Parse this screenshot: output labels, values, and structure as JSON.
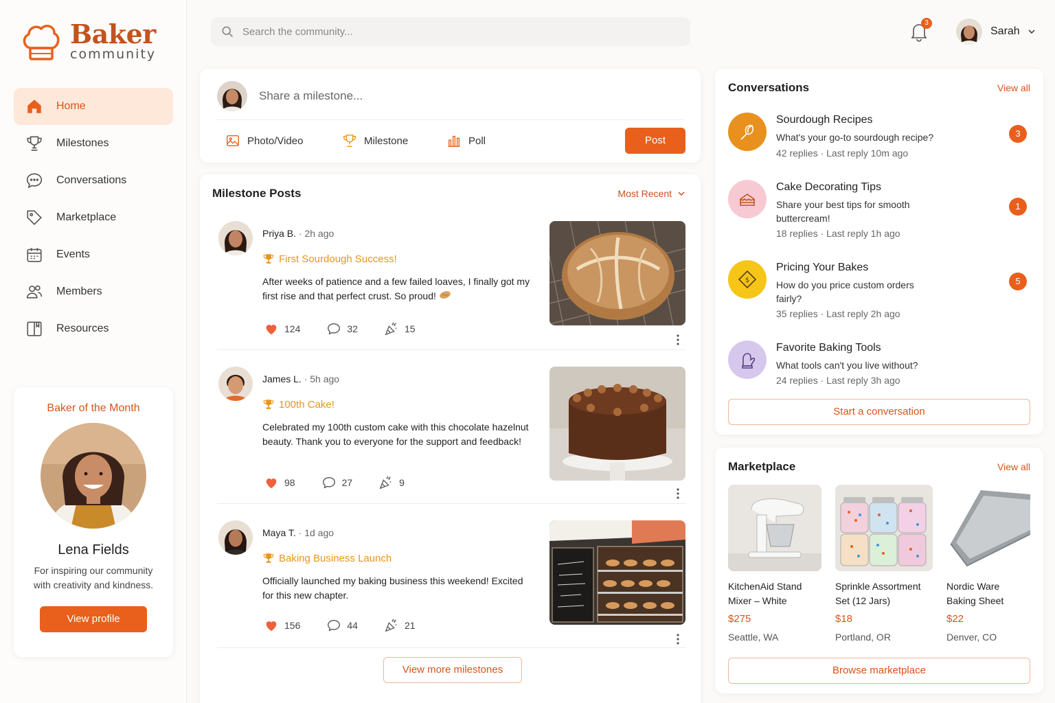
{
  "app": {
    "logo_title": "Baker",
    "logo_sub": "community"
  },
  "colors": {
    "accent": "#e8601c",
    "accent_dark": "#d9541a",
    "active_bg": "#fde8d9",
    "gold": "#e89518"
  },
  "search": {
    "placeholder": "Search the community..."
  },
  "header": {
    "notification_count": "3",
    "user_name": "Sarah"
  },
  "nav": [
    {
      "label": "Home",
      "icon": "home-icon"
    },
    {
      "label": "Milestones",
      "icon": "trophy-icon"
    },
    {
      "label": "Conversations",
      "icon": "chat-bubble-icon"
    },
    {
      "label": "Marketplace",
      "icon": "tag-icon"
    },
    {
      "label": "Events",
      "icon": "calendar-icon"
    },
    {
      "label": "Members",
      "icon": "users-icon"
    },
    {
      "label": "Resources",
      "icon": "book-icon"
    }
  ],
  "baker_of_month": {
    "title": "Baker of the Month",
    "name": "Lena Fields",
    "desc": "For inspiring our community with creativity and kindness.",
    "button": "View profile"
  },
  "composer": {
    "placeholder": "Share a milestone...",
    "photo": "Photo/Video",
    "milestone": "Milestone",
    "poll": "Poll",
    "post": "Post"
  },
  "feed": {
    "title": "Milestone Posts",
    "sort": "Most Recent",
    "more": "View more milestones",
    "posts": [
      {
        "author": "Priya B.",
        "time": "2h ago",
        "tag": "First Sourdough Success!",
        "text": "After weeks of patience and a few failed loaves, I finally got my first rise and that perfect crust. So proud!",
        "likes": "124",
        "comments": "32",
        "cheers": "15"
      },
      {
        "author": "James L.",
        "time": "5h ago",
        "tag": "100th Cake!",
        "text": "Celebrated my 100th custom cake with this chocolate hazelnut beauty. Thank you to everyone for the support and feedback!",
        "likes": "98",
        "comments": "27",
        "cheers": "9"
      },
      {
        "author": "Maya T.",
        "time": "1d ago",
        "tag": "Baking Business Launch",
        "text": "Officially launched my baking business this weekend! Excited for this new chapter.",
        "likes": "156",
        "comments": "44",
        "cheers": "21"
      }
    ]
  },
  "conversations": {
    "title": "Conversations",
    "view_all": "View all",
    "start": "Start a conversation",
    "items": [
      {
        "title": "Sourdough Recipes",
        "desc": "What's your go-to sourdough recipe?",
        "meta": "42 replies · Last reply 10m ago",
        "count": "3",
        "icon": "whisk-icon"
      },
      {
        "title": "Cake Decorating Tips",
        "desc": "Share your best tips for smooth buttercream!",
        "meta": "18 replies · Last reply 1h ago",
        "count": "1",
        "icon": "cake-icon"
      },
      {
        "title": "Pricing Your Bakes",
        "desc": "How do you price custom orders fairly?",
        "meta": "35 replies · Last reply 2h ago",
        "count": "5",
        "icon": "price-tag-icon"
      },
      {
        "title": "Favorite Baking Tools",
        "desc": "What tools can't you live without?",
        "meta": "24 replies · Last reply 3h ago",
        "count": "",
        "icon": "oven-mitt-icon"
      }
    ]
  },
  "marketplace": {
    "title": "Marketplace",
    "view_all": "View all",
    "browse": "Browse marketplace",
    "items": [
      {
        "name": "KitchenAid Stand Mixer – White",
        "price": "$275",
        "location": "Seattle, WA"
      },
      {
        "name": "Sprinkle Assortment Set (12 Jars)",
        "price": "$18",
        "location": "Portland, OR"
      },
      {
        "name": "Nordic Ware Baking Sheet",
        "price": "$22",
        "location": "Denver, CO"
      }
    ]
  }
}
